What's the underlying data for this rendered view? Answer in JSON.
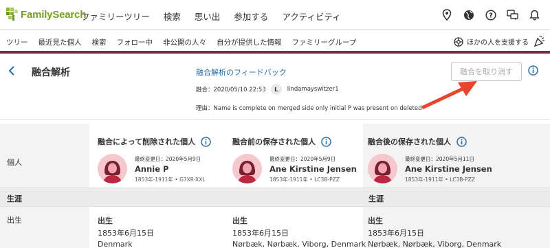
{
  "app": {
    "logo": "FamilySearch"
  },
  "topnav": {
    "items": [
      "ファミリーツリー",
      "検索",
      "思い出",
      "参加する",
      "アクティビティ"
    ],
    "icons": [
      "location-pin-icon",
      "globe-icon",
      "help-icon",
      "chat-icon",
      "bell-icon"
    ]
  },
  "subnav": {
    "items": [
      "ツリー",
      "最近見た個人",
      "検索",
      "フォロー中",
      "非公開の人々",
      "自分が提供した情報",
      "ファミリーグループ"
    ],
    "help_others": "ほかの人を支援する"
  },
  "header": {
    "title": "融合解析",
    "feedback": "融合解析のフィードバック",
    "merge_date": "融合：2020/05/10 22:53",
    "user_initial": "L",
    "user_name": "lindamayswitzer1",
    "reason": "理由：Name is complete on merged side only initial P was present on deleted",
    "undo_button": "融合を取り消す"
  },
  "table": {
    "columns": [
      "融合によって削除された個人",
      "融合前の保存された個人",
      "融合後の保存された個人"
    ],
    "row_person": "個人",
    "section_vitals": "生涯",
    "row_birth": "出生",
    "persons": [
      {
        "modified": "最終変更日：2020年5月9日",
        "name": "Annie P",
        "meta": "1853年-1911年 • G7XR-XXL"
      },
      {
        "modified": "最終変更日：2020年5月9日",
        "name": "Ane Kirstine Jensen",
        "meta": "1853年-1911年 • LC3B-PZZ"
      },
      {
        "modified": "最終変更日：2020年5月11日",
        "name": "Ane Kirstine Jensen",
        "meta": "1853年-1911年 • LC3B-PZZ"
      }
    ],
    "births": [
      {
        "label": "出生",
        "date": "1853年6月15日",
        "place": "Denmark"
      },
      {
        "label": "出生",
        "date": "1853年6月15日",
        "place": "Nørbæk, Nørbæk, Viborg, Denmark"
      },
      {
        "label": "出生",
        "date": "1853年6月15日",
        "place": "Nørbæk, Nørbæk, Viborg, Denmark"
      }
    ]
  },
  "colors": {
    "accent_bar": "#7f2944",
    "link": "#2b6da3",
    "logo_green": "#7a9e1d",
    "arrow": "#e8452c"
  }
}
